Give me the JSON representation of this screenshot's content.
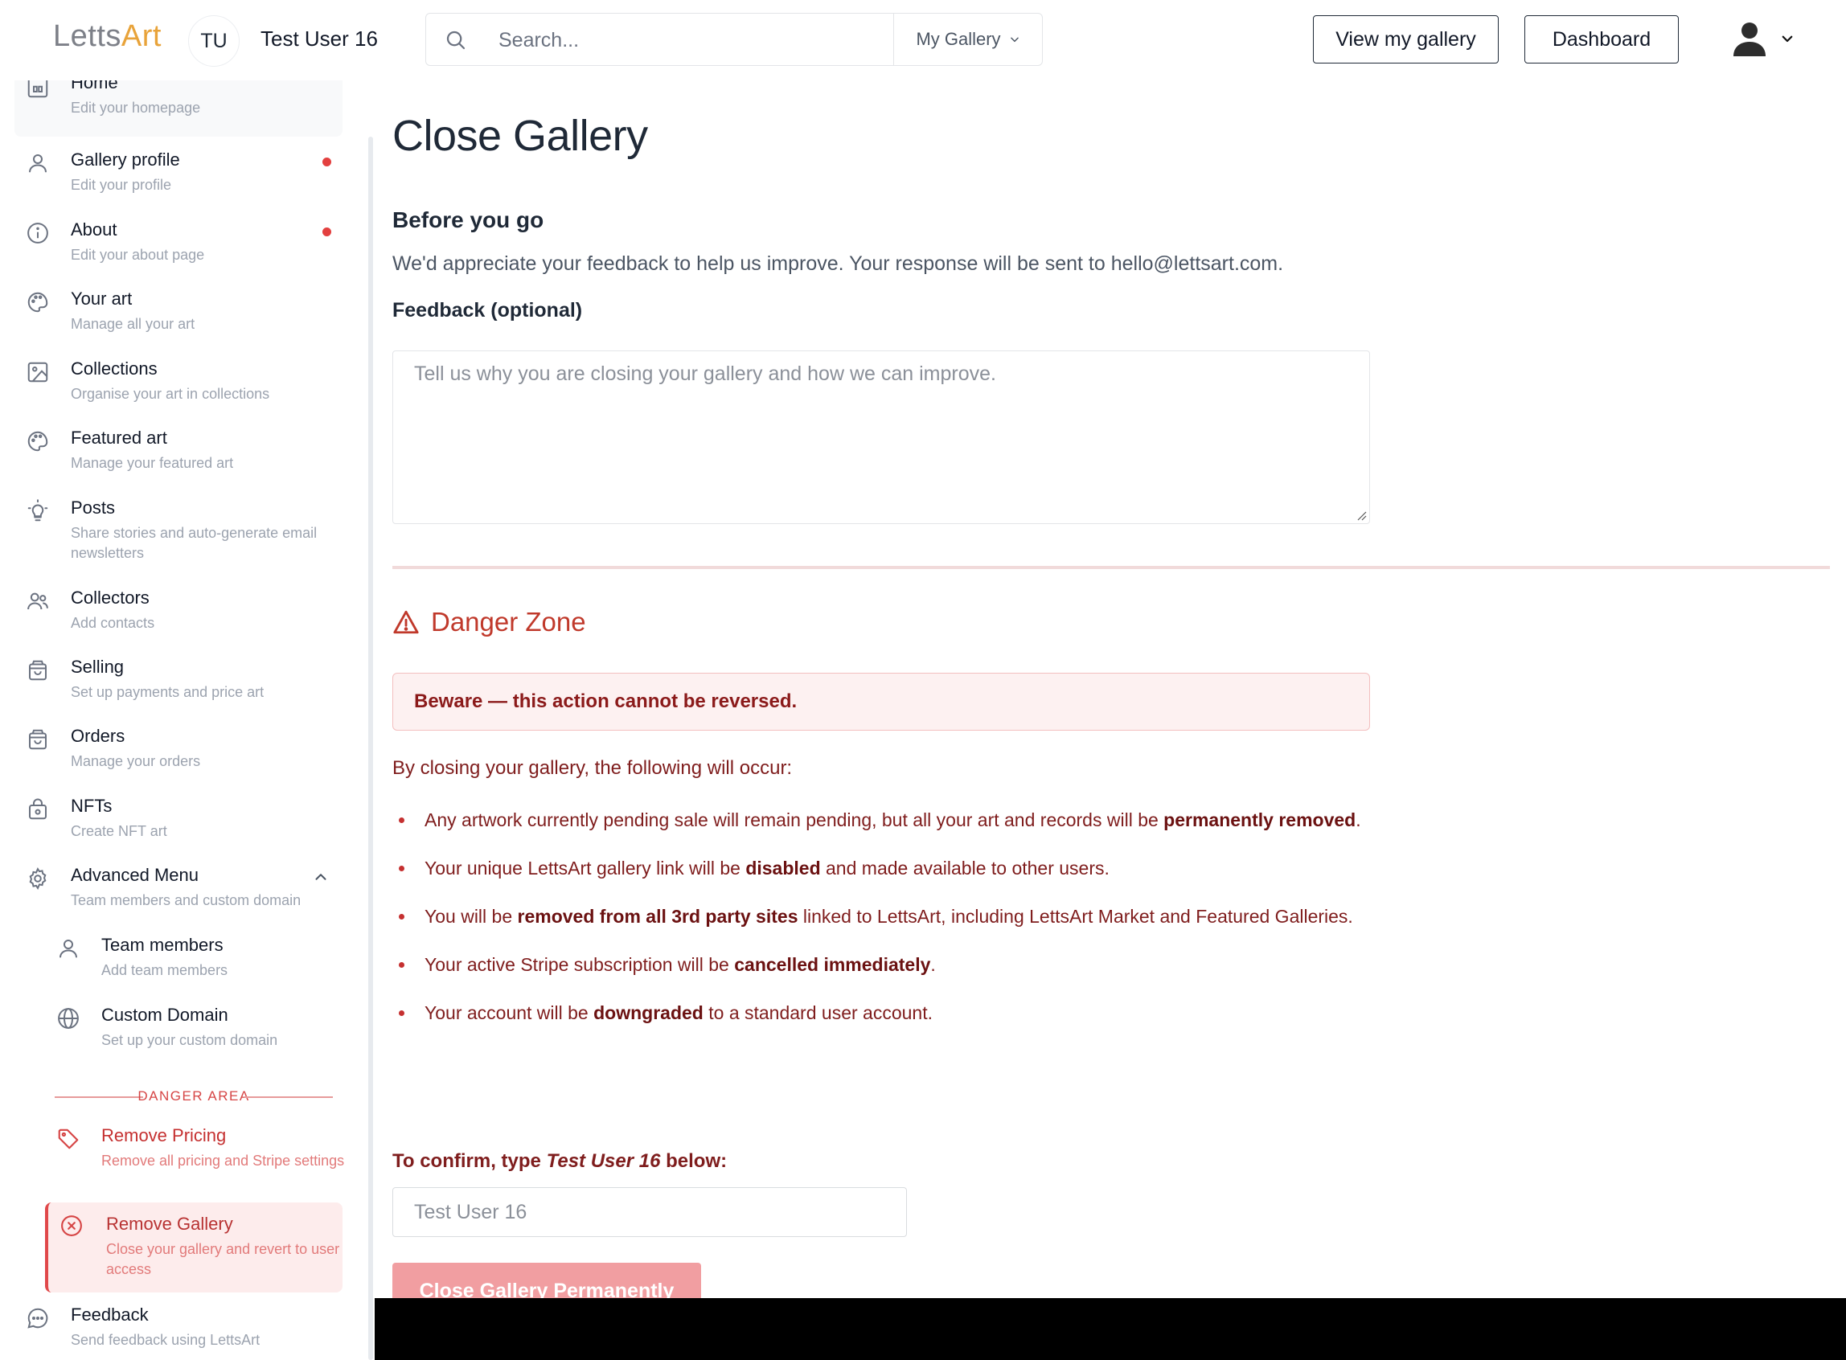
{
  "header": {
    "logo_part1": "Letts",
    "logo_part2": "Art",
    "avatar_initials": "TU",
    "username": "Test User 16",
    "search_placeholder": "Search...",
    "search_scope": "My Gallery",
    "view_gallery_label": "View my gallery",
    "dashboard_label": "Dashboard"
  },
  "sidebar": {
    "items": [
      {
        "title": "Home",
        "subtitle": "Edit your homepage"
      },
      {
        "title": "Gallery profile",
        "subtitle": "Edit your profile"
      },
      {
        "title": "About",
        "subtitle": "Edit your about page"
      },
      {
        "title": "Your art",
        "subtitle": "Manage all your art"
      },
      {
        "title": "Collections",
        "subtitle": "Organise your art in collections"
      },
      {
        "title": "Featured art",
        "subtitle": "Manage your featured art"
      },
      {
        "title": "Posts",
        "subtitle": "Share stories and auto-generate email newsletters"
      },
      {
        "title": "Collectors",
        "subtitle": "Add contacts"
      },
      {
        "title": "Selling",
        "subtitle": "Set up payments and price art"
      },
      {
        "title": "Orders",
        "subtitle": "Manage your orders"
      },
      {
        "title": "NFTs",
        "subtitle": "Create NFT art"
      },
      {
        "title": "Advanced Menu",
        "subtitle": "Team members and custom domain"
      },
      {
        "title": "Team members",
        "subtitle": "Add team members"
      },
      {
        "title": "Custom Domain",
        "subtitle": "Set up your custom domain"
      },
      {
        "title": "Remove Pricing",
        "subtitle": "Remove all pricing and Stripe settings"
      },
      {
        "title": "Remove Gallery",
        "subtitle": "Close your gallery and revert to user access"
      },
      {
        "title": "Feedback",
        "subtitle": "Send feedback using LettsArt"
      }
    ],
    "danger_area_label": "DANGER AREA"
  },
  "main": {
    "title": "Close Gallery",
    "before_heading": "Before you go",
    "feedback_text": "We'd appreciate your feedback to help us improve. Your response will be sent to hello@lettsart.com.",
    "feedback_label": "Feedback (optional)",
    "feedback_placeholder": "Tell us why you are closing your gallery and how we can improve.",
    "danger_title": "Danger Zone",
    "beware_text": "Beware — this action cannot be reversed.",
    "intro_text": "By closing your gallery, the following will occur:",
    "consequences": [
      {
        "pre": "Any artwork currently pending sale will remain pending, but all your art and records will be ",
        "bold": "permanently removed",
        "post": "."
      },
      {
        "pre": "Your unique LettsArt gallery link will be ",
        "bold": "disabled",
        "post": " and made available to other users."
      },
      {
        "pre": "You will be ",
        "bold": "removed from all 3rd party sites",
        "post": " linked to LettsArt, including LettsArt Market and Featured Galleries."
      },
      {
        "pre": "Your active Stripe subscription will be ",
        "bold": "cancelled immediately",
        "post": "."
      },
      {
        "pre": "Your account will be ",
        "bold": "downgraded",
        "post": " to a standard user account."
      }
    ],
    "confirm_pre": "To confirm, type ",
    "confirm_name": "Test User 16",
    "confirm_post": " below:",
    "confirm_placeholder": "Test User 16",
    "close_button_label": "Close Gallery Permanently"
  },
  "colors": {
    "brand_grey": "#7d8088",
    "brand_orange": "#e8a33a",
    "danger_red": "#c0392b",
    "danger_button": "#f19ea1",
    "notification_dot": "#e3403f"
  }
}
